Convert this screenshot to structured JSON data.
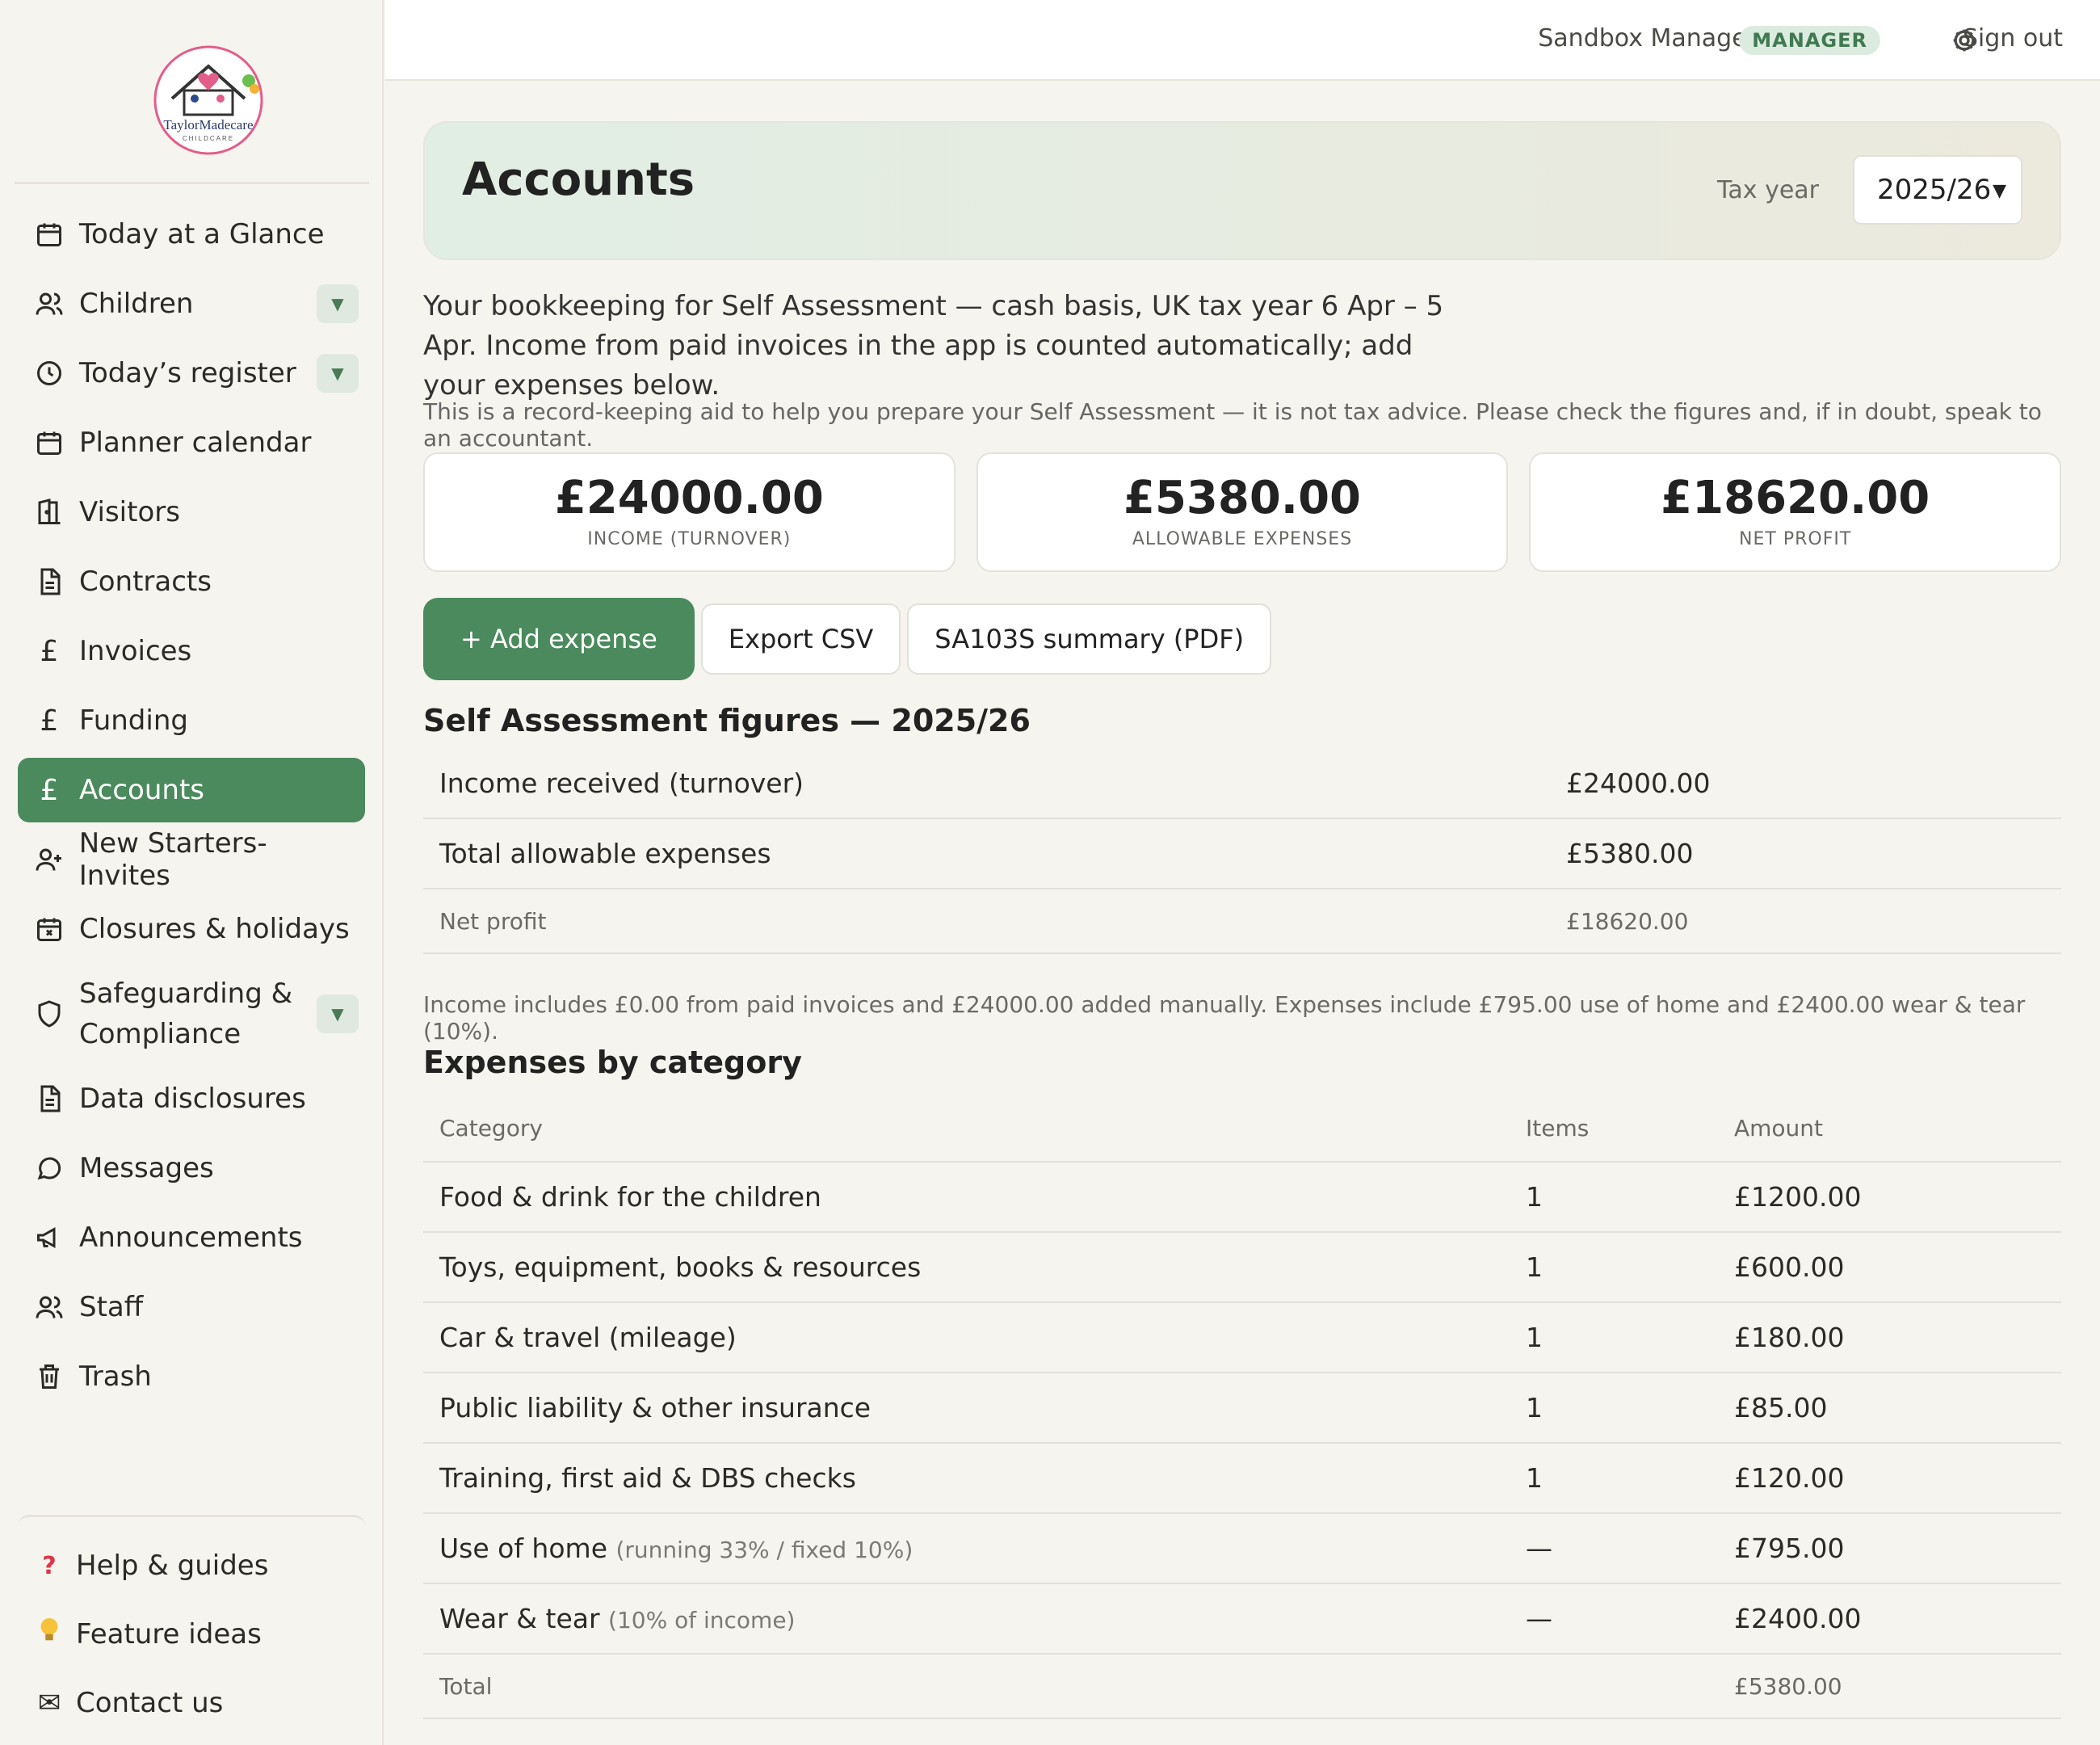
{
  "brand": {
    "logo_text": "TaylorMadecare",
    "logo_sub": "CHILDCARE"
  },
  "sidebar": {
    "items": [
      {
        "label": "Today at a Glance",
        "icon": "calendar-icon"
      },
      {
        "label": "Children",
        "icon": "users-icon",
        "expandable": true
      },
      {
        "label": "Today’s register",
        "icon": "clock-icon",
        "expandable": true
      },
      {
        "label": "Planner calendar",
        "icon": "calendar-icon"
      },
      {
        "label": "Visitors",
        "icon": "door-icon"
      },
      {
        "label": "Contracts",
        "icon": "document-icon"
      },
      {
        "label": "Invoices",
        "icon": "pound-icon"
      },
      {
        "label": "Funding",
        "icon": "pound-icon"
      },
      {
        "label": "Accounts",
        "icon": "pound-icon",
        "active": true
      },
      {
        "label": "New Starters- Invites",
        "icon": "user-plus-icon"
      },
      {
        "label": "Closures & holidays",
        "icon": "calendar-x-icon"
      },
      {
        "label": "Safeguarding & Compliance",
        "icon": "shield-icon",
        "expandable": true
      },
      {
        "label": "Data disclosures",
        "icon": "document-icon"
      },
      {
        "label": "Messages",
        "icon": "chat-icon"
      },
      {
        "label": "Announcements",
        "icon": "megaphone-icon"
      },
      {
        "label": "Staff",
        "icon": "users-icon"
      },
      {
        "label": "Trash",
        "icon": "trash-icon"
      }
    ],
    "bottom": [
      {
        "label": "Help & guides",
        "icon": "❓"
      },
      {
        "label": "Feature ideas",
        "icon": "💡"
      },
      {
        "label": "Contact us",
        "icon": "✉"
      }
    ]
  },
  "topbar": {
    "user": "Sandbox Manager",
    "role": "MANAGER",
    "signout": "Sign out"
  },
  "header": {
    "title": "Accounts",
    "tax_year_label": "Tax year",
    "tax_year_value": "2025/26"
  },
  "intro": "Your bookkeeping for Self Assessment — cash basis, UK tax year 6 Apr – 5 Apr. Income from paid invoices in the app is counted automatically; add your expenses below.",
  "disclaimer": "This is a record-keeping aid to help you prepare your Self Assessment — it is not tax advice. Please check the figures and, if in doubt, speak to an accountant.",
  "stats": [
    {
      "value": "£24000.00",
      "label": "INCOME (TURNOVER)"
    },
    {
      "value": "£5380.00",
      "label": "ALLOWABLE EXPENSES"
    },
    {
      "value": "£18620.00",
      "label": "NET PROFIT"
    }
  ],
  "actions": {
    "add": "+ Add expense",
    "export": "Export CSV",
    "summary": "SA103S summary (PDF)"
  },
  "sa": {
    "title": "Self Assessment figures — 2025/26",
    "rows": [
      {
        "label": "Income received (turnover)",
        "value": "£24000.00"
      },
      {
        "label": "Total allowable expenses",
        "value": "£5380.00"
      },
      {
        "label": "Net profit",
        "value": "£18620.00"
      }
    ],
    "note": "Income includes £0.00 from paid invoices and £24000.00 added manually. Expenses include £795.00 use of home and £2400.00 wear & tear (10%)."
  },
  "expenses": {
    "title": "Expenses by category",
    "headers": [
      "Category",
      "Items",
      "Amount"
    ],
    "rows": [
      {
        "category": "Food & drink for the children",
        "detail": "",
        "items": "1",
        "amount": "£1200.00"
      },
      {
        "category": "Toys, equipment, books & resources",
        "detail": "",
        "items": "1",
        "amount": "£600.00"
      },
      {
        "category": "Car & travel (mileage)",
        "detail": "",
        "items": "1",
        "amount": "£180.00"
      },
      {
        "category": "Public liability & other insurance",
        "detail": "",
        "items": "1",
        "amount": "£85.00"
      },
      {
        "category": "Training, first aid & DBS checks",
        "detail": "",
        "items": "1",
        "amount": "£120.00"
      },
      {
        "category": "Use of home",
        "detail": "(running 33% / fixed 10%)",
        "items": "—",
        "amount": "£795.00"
      },
      {
        "category": "Wear & tear",
        "detail": "(10% of income)",
        "items": "—",
        "amount": "£2400.00"
      }
    ],
    "total_label": "Total",
    "total_value": "£5380.00"
  },
  "colors": {
    "accent": "#4a8a5c",
    "background": "#f6f4ee",
    "badge": "#dcebdf"
  }
}
